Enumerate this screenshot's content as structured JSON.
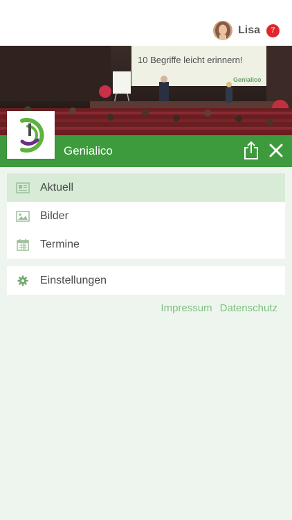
{
  "user": {
    "name": "Lisa",
    "notifications": "7"
  },
  "hero": {
    "screen_text": "10 Begriffe leicht erinnern!",
    "screen_brand": "Genialico"
  },
  "app": {
    "title": "Genialico"
  },
  "menu": {
    "items": [
      {
        "label": "Aktuell",
        "icon": "newspaper-icon",
        "active": true
      },
      {
        "label": "Bilder",
        "icon": "image-icon",
        "active": false
      },
      {
        "label": "Termine",
        "icon": "calendar-icon",
        "active": false
      }
    ],
    "settings": {
      "label": "Einstellungen",
      "icon": "gear-icon"
    }
  },
  "footer": {
    "impressum": "Impressum",
    "datenschutz": "Datenschutz"
  },
  "colors": {
    "brand_green": "#3d9a3d",
    "active_item": "#d7ebd7",
    "background": "#eef5ee",
    "badge": "#e3262d",
    "link": "#7fbf7f"
  }
}
